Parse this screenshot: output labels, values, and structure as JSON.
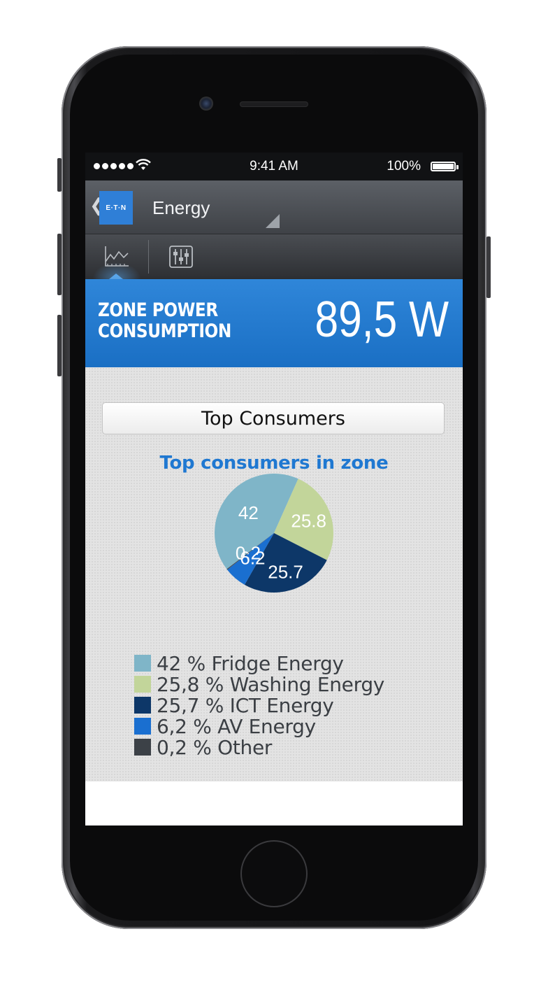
{
  "status_bar": {
    "time": "9:41 AM",
    "battery_text": "100%"
  },
  "app_bar": {
    "logo_text": "E·T·N",
    "title": "Energy"
  },
  "tabs": [
    {
      "icon": "line-chart-icon",
      "active": true
    },
    {
      "icon": "sliders-icon",
      "active": false
    }
  ],
  "hero": {
    "label_line1": "ZONE POWER",
    "label_line2": "CONSUMPTION",
    "value": "89,5 W"
  },
  "section_button": "Top Consumers",
  "chart_data": {
    "type": "pie",
    "title": "Top consumers in zone",
    "slices": [
      {
        "label": "42",
        "value": 42,
        "color": "#7fb5c8",
        "legend": "42 % Fridge Energy"
      },
      {
        "label": "25.8",
        "value": 25.8,
        "color": "#c2d59a",
        "legend": "25,8 % Washing Energy"
      },
      {
        "label": "25.7",
        "value": 25.7,
        "color": "#0d3768",
        "legend": "25,7 % ICT Energy"
      },
      {
        "label": "6.2",
        "value": 6.2,
        "color": "#1a6fd0",
        "legend": "6,2 % AV Energy"
      },
      {
        "label": "0.2",
        "value": 0.2,
        "color": "#3c4147",
        "legend": "0,2 % Other"
      }
    ],
    "label_color": "#ffffff"
  },
  "colors": {
    "hero_blue": "#1f78d1",
    "brand_blue": "#2f7fd7"
  }
}
